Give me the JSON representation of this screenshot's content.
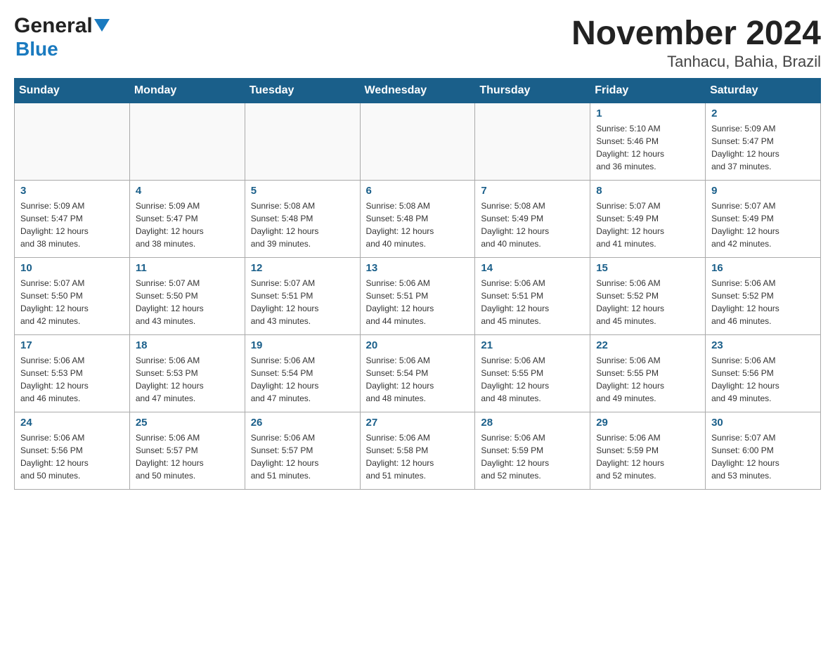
{
  "header": {
    "logo_general": "General",
    "logo_blue": "Blue",
    "month_year": "November 2024",
    "location": "Tanhacu, Bahia, Brazil"
  },
  "days_of_week": [
    "Sunday",
    "Monday",
    "Tuesday",
    "Wednesday",
    "Thursday",
    "Friday",
    "Saturday"
  ],
  "weeks": [
    [
      {
        "day": "",
        "info": ""
      },
      {
        "day": "",
        "info": ""
      },
      {
        "day": "",
        "info": ""
      },
      {
        "day": "",
        "info": ""
      },
      {
        "day": "",
        "info": ""
      },
      {
        "day": "1",
        "info": "Sunrise: 5:10 AM\nSunset: 5:46 PM\nDaylight: 12 hours\nand 36 minutes."
      },
      {
        "day": "2",
        "info": "Sunrise: 5:09 AM\nSunset: 5:47 PM\nDaylight: 12 hours\nand 37 minutes."
      }
    ],
    [
      {
        "day": "3",
        "info": "Sunrise: 5:09 AM\nSunset: 5:47 PM\nDaylight: 12 hours\nand 38 minutes."
      },
      {
        "day": "4",
        "info": "Sunrise: 5:09 AM\nSunset: 5:47 PM\nDaylight: 12 hours\nand 38 minutes."
      },
      {
        "day": "5",
        "info": "Sunrise: 5:08 AM\nSunset: 5:48 PM\nDaylight: 12 hours\nand 39 minutes."
      },
      {
        "day": "6",
        "info": "Sunrise: 5:08 AM\nSunset: 5:48 PM\nDaylight: 12 hours\nand 40 minutes."
      },
      {
        "day": "7",
        "info": "Sunrise: 5:08 AM\nSunset: 5:49 PM\nDaylight: 12 hours\nand 40 minutes."
      },
      {
        "day": "8",
        "info": "Sunrise: 5:07 AM\nSunset: 5:49 PM\nDaylight: 12 hours\nand 41 minutes."
      },
      {
        "day": "9",
        "info": "Sunrise: 5:07 AM\nSunset: 5:49 PM\nDaylight: 12 hours\nand 42 minutes."
      }
    ],
    [
      {
        "day": "10",
        "info": "Sunrise: 5:07 AM\nSunset: 5:50 PM\nDaylight: 12 hours\nand 42 minutes."
      },
      {
        "day": "11",
        "info": "Sunrise: 5:07 AM\nSunset: 5:50 PM\nDaylight: 12 hours\nand 43 minutes."
      },
      {
        "day": "12",
        "info": "Sunrise: 5:07 AM\nSunset: 5:51 PM\nDaylight: 12 hours\nand 43 minutes."
      },
      {
        "day": "13",
        "info": "Sunrise: 5:06 AM\nSunset: 5:51 PM\nDaylight: 12 hours\nand 44 minutes."
      },
      {
        "day": "14",
        "info": "Sunrise: 5:06 AM\nSunset: 5:51 PM\nDaylight: 12 hours\nand 45 minutes."
      },
      {
        "day": "15",
        "info": "Sunrise: 5:06 AM\nSunset: 5:52 PM\nDaylight: 12 hours\nand 45 minutes."
      },
      {
        "day": "16",
        "info": "Sunrise: 5:06 AM\nSunset: 5:52 PM\nDaylight: 12 hours\nand 46 minutes."
      }
    ],
    [
      {
        "day": "17",
        "info": "Sunrise: 5:06 AM\nSunset: 5:53 PM\nDaylight: 12 hours\nand 46 minutes."
      },
      {
        "day": "18",
        "info": "Sunrise: 5:06 AM\nSunset: 5:53 PM\nDaylight: 12 hours\nand 47 minutes."
      },
      {
        "day": "19",
        "info": "Sunrise: 5:06 AM\nSunset: 5:54 PM\nDaylight: 12 hours\nand 47 minutes."
      },
      {
        "day": "20",
        "info": "Sunrise: 5:06 AM\nSunset: 5:54 PM\nDaylight: 12 hours\nand 48 minutes."
      },
      {
        "day": "21",
        "info": "Sunrise: 5:06 AM\nSunset: 5:55 PM\nDaylight: 12 hours\nand 48 minutes."
      },
      {
        "day": "22",
        "info": "Sunrise: 5:06 AM\nSunset: 5:55 PM\nDaylight: 12 hours\nand 49 minutes."
      },
      {
        "day": "23",
        "info": "Sunrise: 5:06 AM\nSunset: 5:56 PM\nDaylight: 12 hours\nand 49 minutes."
      }
    ],
    [
      {
        "day": "24",
        "info": "Sunrise: 5:06 AM\nSunset: 5:56 PM\nDaylight: 12 hours\nand 50 minutes."
      },
      {
        "day": "25",
        "info": "Sunrise: 5:06 AM\nSunset: 5:57 PM\nDaylight: 12 hours\nand 50 minutes."
      },
      {
        "day": "26",
        "info": "Sunrise: 5:06 AM\nSunset: 5:57 PM\nDaylight: 12 hours\nand 51 minutes."
      },
      {
        "day": "27",
        "info": "Sunrise: 5:06 AM\nSunset: 5:58 PM\nDaylight: 12 hours\nand 51 minutes."
      },
      {
        "day": "28",
        "info": "Sunrise: 5:06 AM\nSunset: 5:59 PM\nDaylight: 12 hours\nand 52 minutes."
      },
      {
        "day": "29",
        "info": "Sunrise: 5:06 AM\nSunset: 5:59 PM\nDaylight: 12 hours\nand 52 minutes."
      },
      {
        "day": "30",
        "info": "Sunrise: 5:07 AM\nSunset: 6:00 PM\nDaylight: 12 hours\nand 53 minutes."
      }
    ]
  ]
}
